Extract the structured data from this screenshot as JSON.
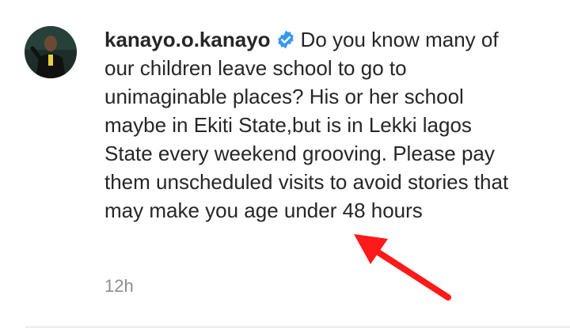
{
  "comment": {
    "avatar_icon": "user-avatar",
    "username": "kanayo.o.kanayo",
    "verified_icon": "verified-badge-icon",
    "verified_color": "#3897f0",
    "text": "Do you know many of our children leave school to go to unimaginable places? His or her school maybe in Ekiti State,but is in Lekki lagos State every weekend grooving. Please pay them unscheduled visits to avoid stories that may make you age under 48 hours",
    "timestamp": "12h"
  },
  "annotation": {
    "arrow_color": "#ff1a1a",
    "arrow_icon": "red-arrow-icon"
  }
}
